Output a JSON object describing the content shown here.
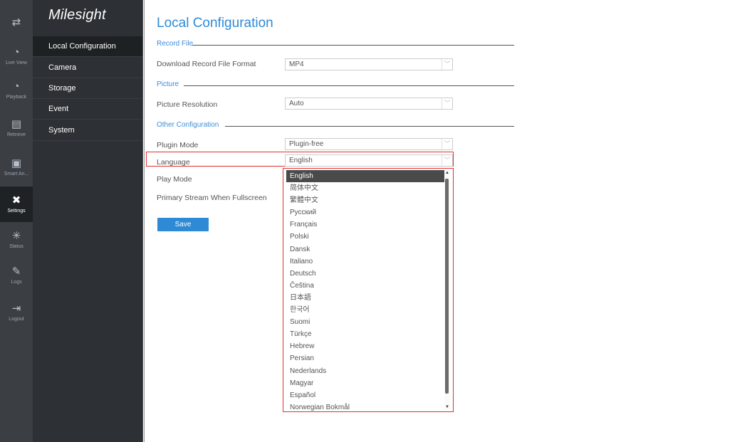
{
  "iconbar": {
    "items": [
      {
        "icon": "swap-icon",
        "label": ""
      },
      {
        "icon": "live-view-icon",
        "label": "Live View"
      },
      {
        "icon": "playback-icon",
        "label": "Playback"
      },
      {
        "icon": "retrieve-icon",
        "label": "Retrieve"
      },
      {
        "icon": "smart-analysis-icon",
        "label": "Smart An..."
      },
      {
        "icon": "settings-icon",
        "label": "Settings"
      },
      {
        "icon": "status-icon",
        "label": "Status"
      },
      {
        "icon": "logs-icon",
        "label": "Logs"
      },
      {
        "icon": "logout-icon",
        "label": "Logout"
      }
    ]
  },
  "brand": {
    "logo_text": "Milesight"
  },
  "menu": {
    "items": [
      {
        "label": "Local Configuration"
      },
      {
        "label": "Camera"
      },
      {
        "label": "Storage"
      },
      {
        "label": "Event"
      },
      {
        "label": "System"
      }
    ]
  },
  "page": {
    "title": "Local Configuration",
    "sections": {
      "record_file": "Record File",
      "picture": "Picture",
      "other": "Other Configuration"
    },
    "fields": {
      "download_format": {
        "label": "Download Record File Format",
        "value": "MP4"
      },
      "picture_resolution": {
        "label": "Picture Resolution",
        "value": "Auto"
      },
      "plugin_mode": {
        "label": "Plugin Mode",
        "value": "Plugin-free"
      },
      "language": {
        "label": "Language",
        "value": "English"
      },
      "play_mode": {
        "label": "Play Mode"
      },
      "primary_stream": {
        "label": "Primary Stream When Fullscreen"
      }
    },
    "save_label": "Save"
  },
  "dropdown": {
    "options": [
      "English",
      "简体中文",
      "繁體中文",
      "Русский",
      "Français",
      "Polski",
      "Dansk",
      "Italiano",
      "Deutsch",
      "Čeština",
      "日本語",
      "한국어",
      "Suomi",
      "Türkçe",
      "Hebrew",
      "Persian",
      "Nederlands",
      "Magyar",
      "Español",
      "Norwegian Bokmål"
    ],
    "selected": "English"
  },
  "colors": {
    "accent": "#2f8ad6",
    "highlight": "#e03030",
    "sidebar": "#2d3034"
  }
}
